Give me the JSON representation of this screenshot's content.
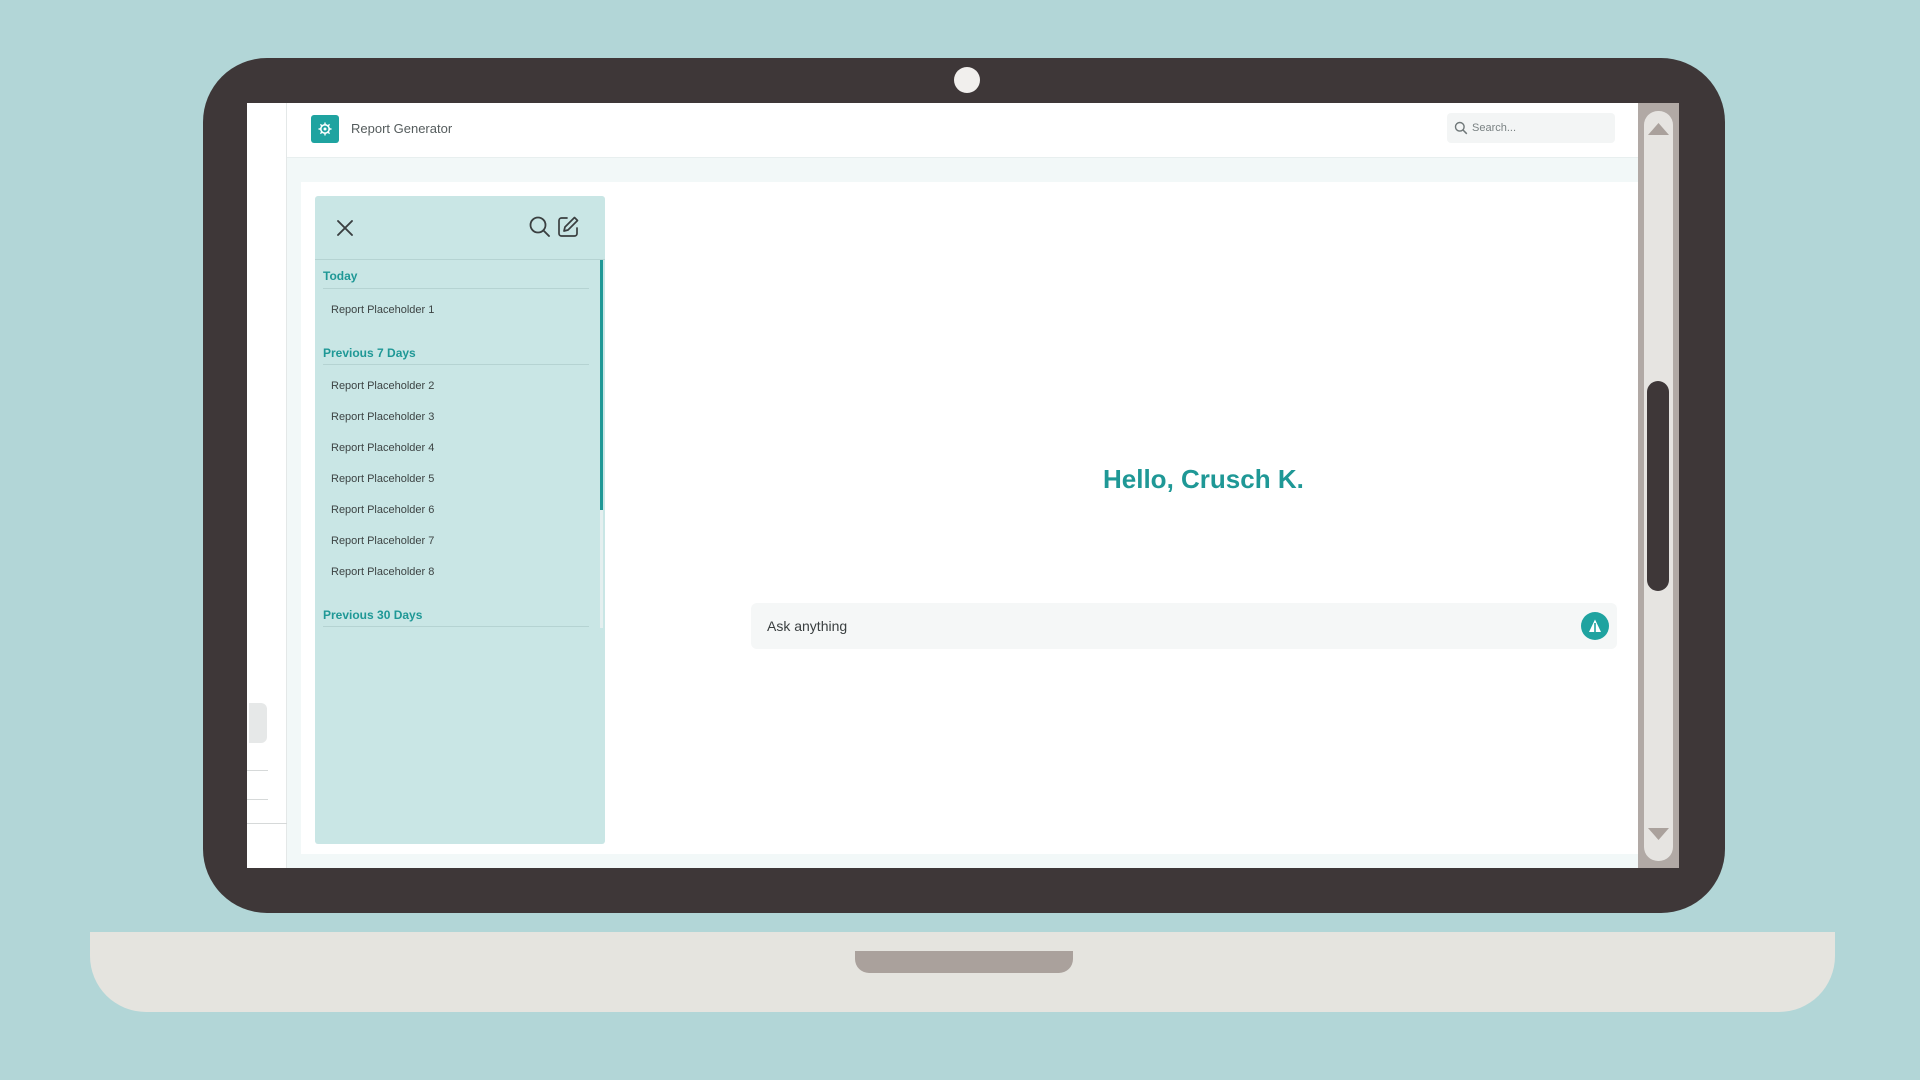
{
  "app": {
    "title": "Report Generator",
    "logo_icon": "report-gear-icon",
    "accent_color": "#1fa3a0"
  },
  "search": {
    "placeholder": "Search..."
  },
  "history": {
    "groups": [
      {
        "label": "Today",
        "items": [
          "Report Placeholder 1"
        ]
      },
      {
        "label": "Previous 7 Days",
        "items": [
          "Report Placeholder 2",
          "Report Placeholder 3",
          "Report Placeholder 4",
          "Report Placeholder 5",
          "Report Placeholder 6",
          "Report Placeholder 7",
          "Report Placeholder 8"
        ]
      },
      {
        "label": "Previous 30 Days",
        "items": []
      }
    ]
  },
  "main": {
    "greeting": "Hello, Crusch K.",
    "ask_placeholder": "Ask anything"
  }
}
